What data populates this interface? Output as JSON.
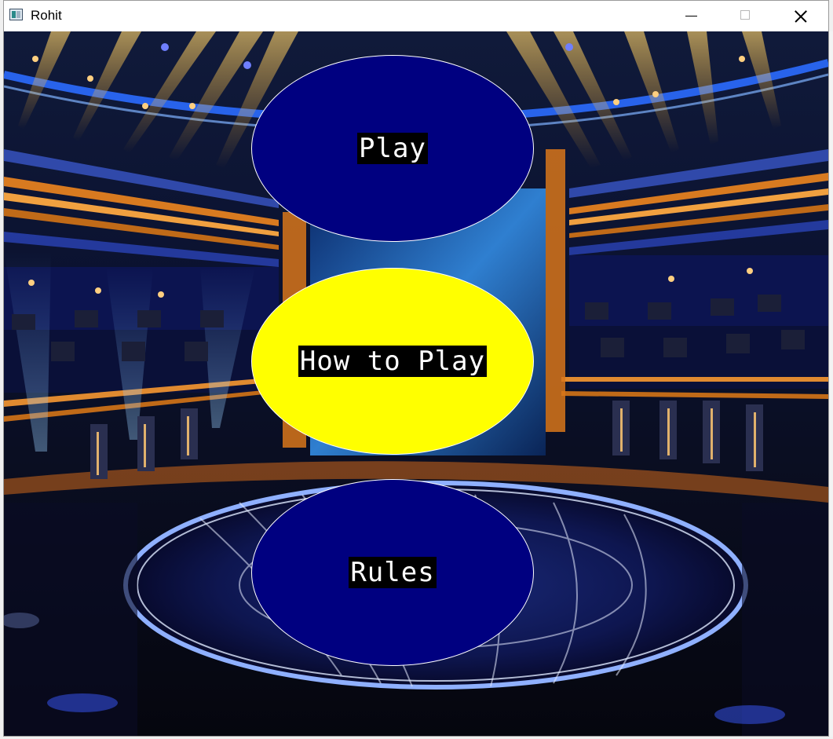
{
  "window": {
    "title": "Rohit",
    "controls": {
      "minimize": "minimize",
      "maximize": "maximize",
      "close": "close"
    }
  },
  "menu": {
    "buttons": [
      {
        "label": "Play",
        "fill": "#000080"
      },
      {
        "label": "How to Play",
        "fill": "#ffff00"
      },
      {
        "label": "Rules",
        "fill": "#000080"
      }
    ],
    "label_colors": {
      "text": "#ffffff",
      "background": "#000000"
    }
  },
  "background": {
    "icon": "game-show-studio-backdrop",
    "accent_colors": [
      "#1e46c8",
      "#f0a020",
      "#ffcc44",
      "#0a1a5a"
    ]
  }
}
